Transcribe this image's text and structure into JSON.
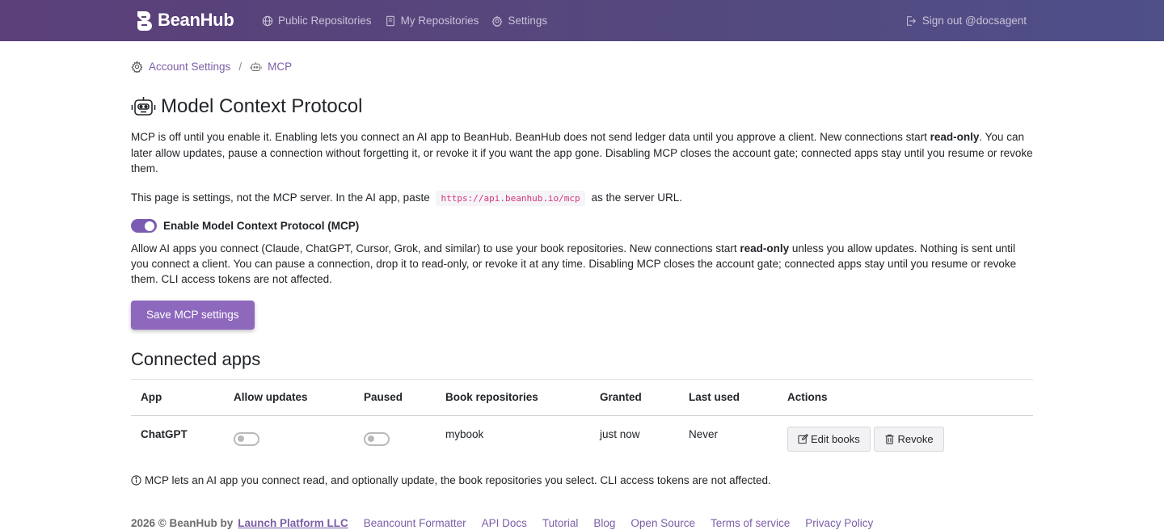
{
  "nav": {
    "brand": "BeanHub",
    "items": [
      {
        "label": "Public Repositories",
        "icon": "globe-icon"
      },
      {
        "label": "My Repositories",
        "icon": "book-icon"
      },
      {
        "label": "Settings",
        "icon": "gear-icon"
      }
    ],
    "signout": "Sign out @docsagent"
  },
  "breadcrumb": {
    "account": "Account Settings",
    "separator": "/",
    "current": "MCP"
  },
  "page": {
    "title": "Model Context Protocol",
    "intro_1": "MCP is off until you enable it. Enabling lets you connect an AI app to BeanHub. BeanHub does not send ledger data until you approve a client. New connections start ",
    "intro_bold": "read-only",
    "intro_2": ". You can later allow updates, pause a connection without forgetting it, or revoke it if you want the app gone. Disabling MCP closes the account gate; connected apps stay until you resume or revoke them.",
    "url_prefix": "This page is settings, not the MCP server. In the AI app, paste",
    "url": "https://api.beanhub.io/mcp",
    "url_suffix": "as the server URL.",
    "toggle_label": "Enable Model Context Protocol (MCP)",
    "toggle_on": true,
    "help_1": "Allow AI apps you connect (Claude, ChatGPT, Cursor, Grok, and similar) to use your book repositories. New connections start ",
    "help_bold": "read-only",
    "help_2": " unless you allow updates. Nothing is sent until you connect a client. You can pause a connection, drop it to read-only, or revoke it at any time. Disabling MCP closes the account gate; connected apps stay until you resume or revoke them. CLI access tokens are not affected.",
    "save_label": "Save MCP settings"
  },
  "connected": {
    "title": "Connected apps",
    "columns": [
      "App",
      "Allow updates",
      "Paused",
      "Book repositories",
      "Granted",
      "Last used",
      "Actions"
    ],
    "rows": [
      {
        "app": "ChatGPT",
        "allow_updates": false,
        "paused": false,
        "books": "mybook",
        "granted": "just now",
        "last_used": "Never",
        "edit_label": "Edit books",
        "revoke_label": "Revoke"
      }
    ],
    "note": "MCP lets an AI app you connect read, and optionally update, the book repositories you select. CLI access tokens are not affected."
  },
  "footer": {
    "copyright": "2026 © BeanHub by",
    "company": "Launch Platform LLC",
    "links": [
      "Beancount Formatter",
      "API Docs",
      "Tutorial",
      "Blog",
      "Open Source",
      "Terms of service",
      "Privacy Policy"
    ]
  },
  "colors": {
    "nav_bg": "#5b3f79",
    "accent": "#8e68bd",
    "link": "#7b5ea7",
    "code": "#d63384"
  }
}
